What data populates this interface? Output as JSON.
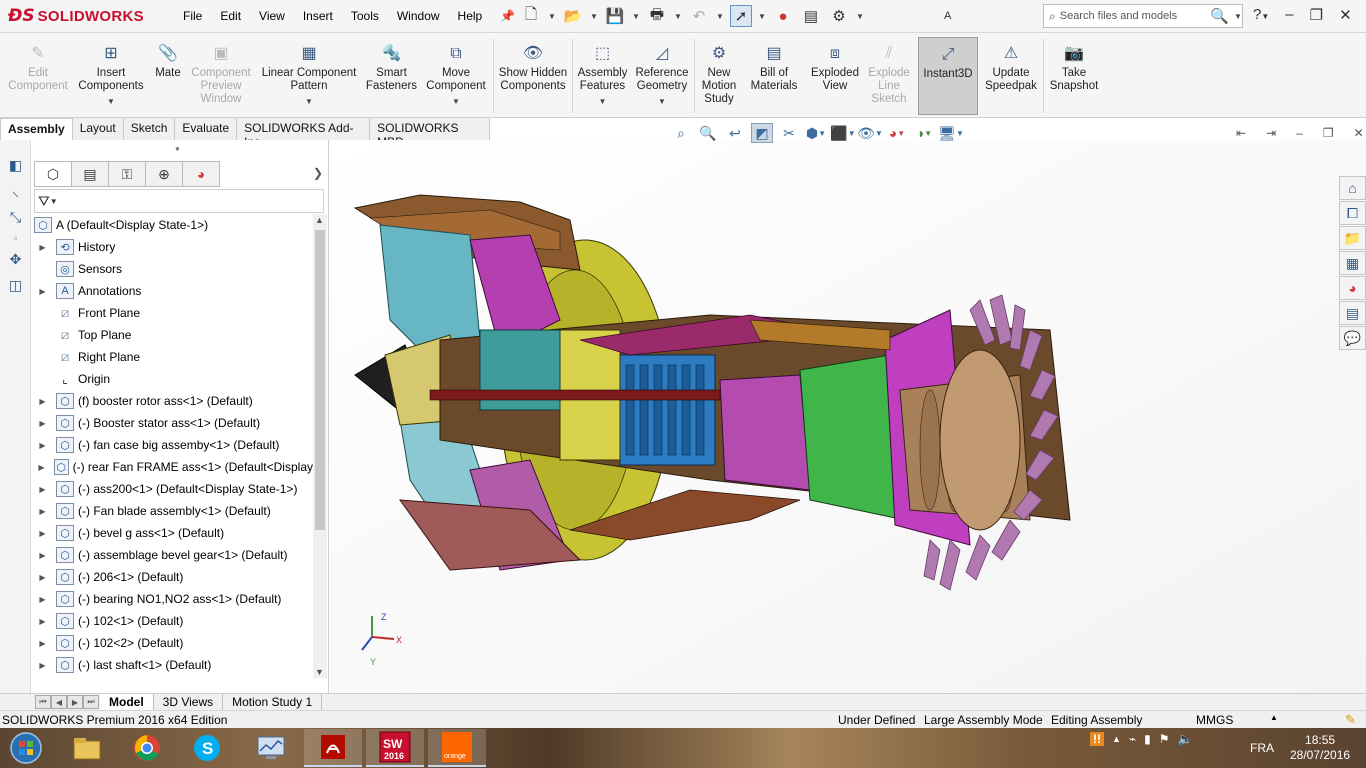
{
  "app": {
    "brand": "SOLIDWORKS",
    "document_title": "A",
    "edition": "SOLIDWORKS Premium 2016 x64 Edition"
  },
  "menu": [
    "File",
    "Edit",
    "View",
    "Insert",
    "Tools",
    "Window",
    "Help"
  ],
  "search": {
    "placeholder": "Search files and models"
  },
  "commands": [
    {
      "label": "Edit Component",
      "icon": "edit-component-icon",
      "enabled": false
    },
    {
      "label": "Insert Components",
      "icon": "insert-components-icon",
      "enabled": true,
      "dropdown": true
    },
    {
      "label": "Mate",
      "icon": "mate-icon",
      "enabled": true
    },
    {
      "label": "Component Preview Window",
      "icon": "component-preview-icon",
      "enabled": false
    },
    {
      "label": "Linear Component Pattern",
      "icon": "linear-pattern-icon",
      "enabled": true,
      "dropdown": true
    },
    {
      "label": "Smart Fasteners",
      "icon": "smart-fasteners-icon",
      "enabled": true
    },
    {
      "label": "Move Component",
      "icon": "move-component-icon",
      "enabled": true,
      "dropdown": true
    },
    {
      "label": "Show Hidden Components",
      "icon": "show-hidden-icon",
      "enabled": true
    },
    {
      "label": "Assembly Features",
      "icon": "assembly-features-icon",
      "enabled": true,
      "dropdown": true
    },
    {
      "label": "Reference Geometry",
      "icon": "reference-geometry-icon",
      "enabled": true,
      "dropdown": true
    },
    {
      "label": "New Motion Study",
      "icon": "motion-study-icon",
      "enabled": true
    },
    {
      "label": "Bill of Materials",
      "icon": "bom-icon",
      "enabled": true
    },
    {
      "label": "Exploded View",
      "icon": "exploded-view-icon",
      "enabled": true
    },
    {
      "label": "Explode Line Sketch",
      "icon": "explode-line-icon",
      "enabled": false
    },
    {
      "label": "Instant3D",
      "icon": "instant3d-icon",
      "enabled": true,
      "active": true
    },
    {
      "label": "Update Speedpak",
      "icon": "speedpak-icon",
      "enabled": true
    },
    {
      "label": "Take Snapshot",
      "icon": "snapshot-icon",
      "enabled": true
    }
  ],
  "cmd_tabs": [
    "Assembly",
    "Layout",
    "Sketch",
    "Evaluate",
    "SOLIDWORKS Add-Ins",
    "SOLIDWORKS MBD"
  ],
  "tree": {
    "root": "A  (Default<Display State-1>)",
    "items": [
      {
        "label": "History",
        "kind": "folder",
        "expand": true
      },
      {
        "label": "Sensors",
        "kind": "folder",
        "expand": false
      },
      {
        "label": "Annotations",
        "kind": "folder",
        "expand": true
      },
      {
        "label": "Front Plane",
        "kind": "plane",
        "expand": false
      },
      {
        "label": "Top Plane",
        "kind": "plane",
        "expand": false
      },
      {
        "label": "Right Plane",
        "kind": "plane",
        "expand": false
      },
      {
        "label": "Origin",
        "kind": "origin",
        "expand": false
      },
      {
        "label": "(f) booster rotor ass<1> (Default)",
        "kind": "asm",
        "expand": true
      },
      {
        "label": "(-) Booster stator ass<1> (Default)",
        "kind": "asm",
        "expand": true
      },
      {
        "label": "(-) fan case   big assemby<1> (Default)",
        "kind": "asm",
        "expand": true
      },
      {
        "label": "(-) rear Fan FRAME ass<1> (Default<Display",
        "kind": "asm",
        "expand": true
      },
      {
        "label": "(-) ass200<1> (Default<Display State-1>)",
        "kind": "asm",
        "expand": true
      },
      {
        "label": "(-) Fan blade assembly<1> (Default)",
        "kind": "asm",
        "expand": true
      },
      {
        "label": "(-) bevel g ass<1> (Default)",
        "kind": "asm",
        "expand": true
      },
      {
        "label": "(-) assemblage bevel gear<1> (Default)",
        "kind": "asm",
        "expand": true
      },
      {
        "label": "(-) 206<1> (Default)",
        "kind": "asm",
        "expand": true
      },
      {
        "label": "(-) bearing NO1,NO2 ass<1> (Default)",
        "kind": "asm",
        "expand": true
      },
      {
        "label": "(-) 102<1> (Default)",
        "kind": "asm",
        "expand": true
      },
      {
        "label": "(-) 102<2> (Default)",
        "kind": "asm",
        "expand": true
      },
      {
        "label": "(-) last shaft<1> (Default)",
        "kind": "asm",
        "expand": true
      }
    ]
  },
  "bottom_tabs": [
    "Model",
    "3D Views",
    "Motion Study 1"
  ],
  "status": {
    "state": "Under Defined",
    "mode": "Large Assembly Mode",
    "editing": "Editing Assembly",
    "units": "MMGS"
  },
  "taskbar": {
    "apps": [
      "explorer-icon",
      "chrome-icon",
      "skype-icon",
      "monitor-icon",
      "acrobat-icon",
      "solidworks-2016-icon",
      "orange-icon"
    ],
    "sw_badge": "2016",
    "orange_label": "orange",
    "lang": "FRA",
    "time": "18:55",
    "date": "28/07/2016"
  },
  "triad": {
    "x": "X",
    "y": "Y",
    "z": "Z"
  },
  "colors": {
    "brand": "#c8102e",
    "accent": "#2b5d92",
    "active_cmd": "#cfcfcf"
  }
}
